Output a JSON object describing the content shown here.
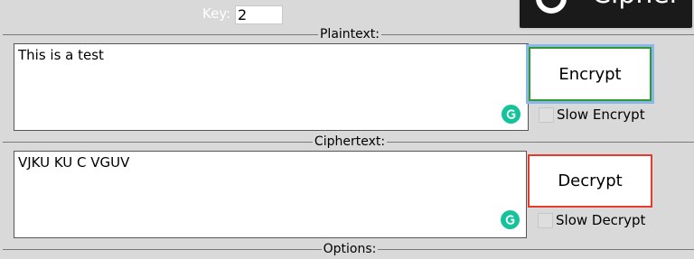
{
  "key": {
    "label": "Key:",
    "value": "2"
  },
  "top_button": {
    "label": "Cipher"
  },
  "plaintext": {
    "title": "Plaintext:",
    "text": "This is a test"
  },
  "ciphertext": {
    "title": "Ciphertext:",
    "text": "VJKU KU C VGUV"
  },
  "actions": {
    "encrypt_label": "Encrypt",
    "decrypt_label": "Decrypt",
    "slow_encrypt_label": "Slow Encrypt",
    "slow_decrypt_label": "Slow Decrypt"
  },
  "options": {
    "title": "Options:"
  },
  "colors": {
    "background": "#d9d9d9",
    "encrypt_border": "#2e9a33",
    "encrypt_focus_ring": "#8bb6e8",
    "decrypt_border": "#e53b2f",
    "grammarly": "#15c39a"
  },
  "icons": {
    "grammarly": "grammarly-icon"
  }
}
